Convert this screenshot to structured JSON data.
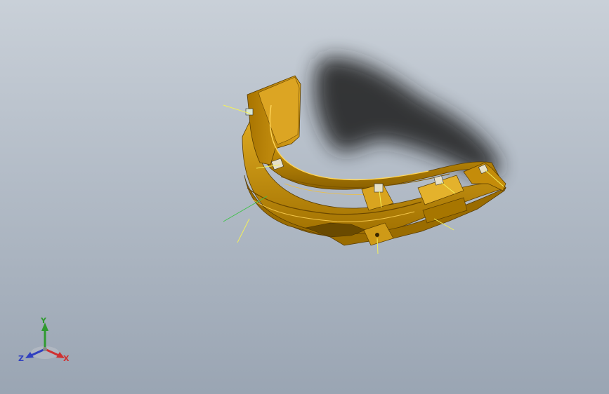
{
  "viewport": {
    "background_top": "#c9d0d8",
    "background_bottom": "#9aa5b3"
  },
  "model": {
    "part_color": "#c9920a",
    "highlight_color": "#e8b52a",
    "dark_color": "#7a5400",
    "shadow_color": "#1e1e1e"
  },
  "triad": {
    "x_label": "X",
    "y_label": "Y",
    "z_label": "Z",
    "x_color": "#d03030",
    "y_color": "#2f9a2f",
    "z_color": "#3040c0"
  }
}
